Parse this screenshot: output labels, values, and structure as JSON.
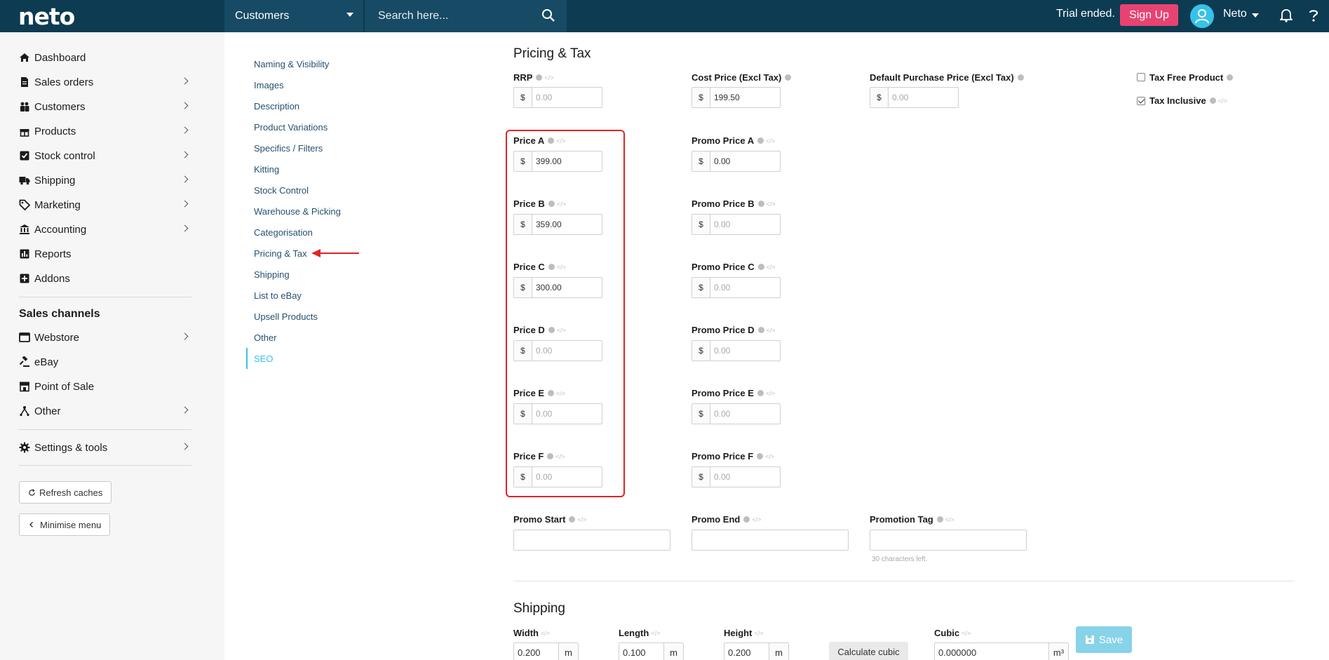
{
  "topbar": {
    "logo": "neto",
    "context_select": "Customers",
    "search_placeholder": "Search here...",
    "trial_text": "Trial ended.",
    "signup_label": "Sign Up",
    "user_name": "Neto"
  },
  "sidebar": {
    "items": [
      {
        "label": "Dashboard",
        "icon": "home-icon",
        "has_submenu": false
      },
      {
        "label": "Sales orders",
        "icon": "document-icon",
        "has_submenu": true
      },
      {
        "label": "Customers",
        "icon": "users-icon",
        "has_submenu": true
      },
      {
        "label": "Products",
        "icon": "gift-icon",
        "has_submenu": true
      },
      {
        "label": "Stock control",
        "icon": "checkbox-icon",
        "has_submenu": true
      },
      {
        "label": "Shipping",
        "icon": "truck-icon",
        "has_submenu": true
      },
      {
        "label": "Marketing",
        "icon": "tag-icon",
        "has_submenu": true
      },
      {
        "label": "Accounting",
        "icon": "bank-icon",
        "has_submenu": true
      },
      {
        "label": "Reports",
        "icon": "bar-chart-icon",
        "has_submenu": false
      },
      {
        "label": "Addons",
        "icon": "plus-square-icon",
        "has_submenu": false
      }
    ],
    "channels_heading": "Sales channels",
    "channels": [
      {
        "label": "Webstore",
        "icon": "browser-icon",
        "has_submenu": true
      },
      {
        "label": "eBay",
        "icon": "gavel-icon",
        "has_submenu": false
      },
      {
        "label": "Point of Sale",
        "icon": "store-icon",
        "has_submenu": false
      },
      {
        "label": "Other",
        "icon": "sitemap-icon",
        "has_submenu": true
      }
    ],
    "settings_label": "Settings & tools",
    "refresh_label": "Refresh caches",
    "minimise_label": "Minimise menu"
  },
  "section_nav": {
    "items": [
      "Naming & Visibility",
      "Images",
      "Description",
      "Product Variations",
      "Specifics / Filters",
      "Kitting",
      "Stock Control",
      "Warehouse & Picking",
      "Categorisation",
      "Pricing & Tax",
      "Shipping",
      "List to eBay",
      "Upsell Products",
      "Other",
      "SEO"
    ],
    "active": "SEO"
  },
  "pricing": {
    "title": "Pricing & Tax",
    "currency": "$",
    "rrp": {
      "label": "RRP",
      "value": "",
      "placeholder": "0.00"
    },
    "cost_price": {
      "label": "Cost Price (Excl Tax)",
      "value": "199.50"
    },
    "default_purchase_price": {
      "label": "Default Purchase Price (Excl Tax)",
      "value": "",
      "placeholder": "0.00"
    },
    "tax_free": {
      "label": "Tax Free Product",
      "checked": false
    },
    "tax_inclusive": {
      "label": "Tax Inclusive",
      "checked": true
    },
    "prices": [
      {
        "label": "Price A",
        "value": "399.00",
        "promo_label": "Promo Price A",
        "promo_value": "0.00"
      },
      {
        "label": "Price B",
        "value": "359.00",
        "promo_label": "Promo Price B",
        "promo_value": "0.00"
      },
      {
        "label": "Price C",
        "value": "300.00",
        "promo_label": "Promo Price C",
        "promo_value": "0.00"
      },
      {
        "label": "Price D",
        "value": "",
        "placeholder": "0.00",
        "promo_label": "Promo Price D",
        "promo_value": "0.00"
      },
      {
        "label": "Price E",
        "value": "",
        "placeholder": "0.00",
        "promo_label": "Promo Price E",
        "promo_value": "0.00"
      },
      {
        "label": "Price F",
        "value": "",
        "placeholder": "0.00",
        "promo_label": "Promo Price F",
        "promo_value": "0.00"
      }
    ],
    "promo_start_label": "Promo Start",
    "promo_end_label": "Promo End",
    "promotion_tag_label": "Promotion Tag",
    "promotion_tag_hint": "30 characters left."
  },
  "shipping": {
    "title": "Shipping",
    "width": {
      "label": "Width",
      "value": "0.200",
      "unit": "m"
    },
    "length": {
      "label": "Length",
      "value": "0.100",
      "unit": "m"
    },
    "height": {
      "label": "Height",
      "value": "0.200",
      "unit": "m"
    },
    "calc_label": "Calculate cubic",
    "cubic": {
      "label": "Cubic",
      "value": "0.000000",
      "unit": "m³"
    }
  },
  "save_label": "Save",
  "colors": {
    "topbar": "#0d3b52",
    "accent": "#36c2e8",
    "signup": "#e74372",
    "annotation": "#e02424"
  }
}
